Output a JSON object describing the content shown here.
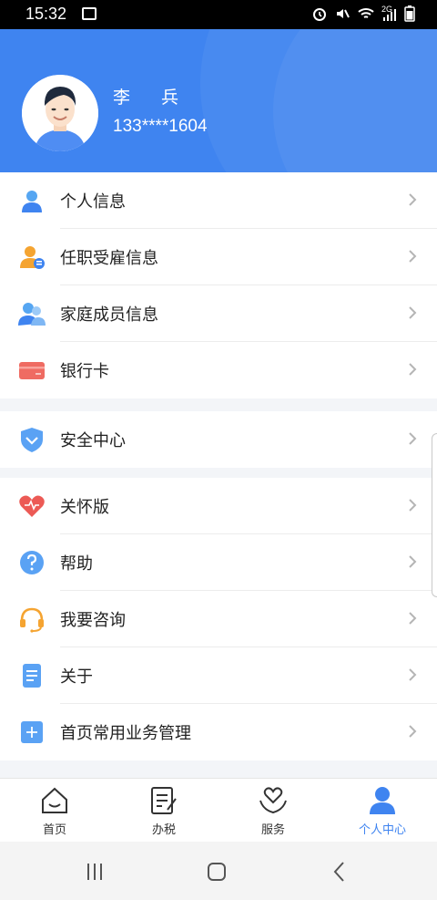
{
  "status_bar": {
    "time": "15:32",
    "icons": [
      "image-icon",
      "alarm-icon",
      "mute-icon",
      "wifi-icon",
      "signal-icon",
      "battery-icon"
    ],
    "network": "2G"
  },
  "profile": {
    "name": "李 兵",
    "phone": "133****1604"
  },
  "menu_groups": [
    [
      {
        "label": "个人信息",
        "icon": "person-icon"
      },
      {
        "label": "任职受雇信息",
        "icon": "employment-icon"
      },
      {
        "label": "家庭成员信息",
        "icon": "family-icon"
      },
      {
        "label": "银行卡",
        "icon": "bank-card-icon"
      }
    ],
    [
      {
        "label": "安全中心",
        "icon": "shield-icon"
      }
    ],
    [
      {
        "label": "关怀版",
        "icon": "heart-icon"
      },
      {
        "label": "帮助",
        "icon": "help-icon"
      },
      {
        "label": "我要咨询",
        "icon": "headset-icon"
      },
      {
        "label": "关于",
        "icon": "document-icon"
      },
      {
        "label": "首页常用业务管理",
        "icon": "plus-square-icon"
      }
    ]
  ],
  "tabs": [
    {
      "label": "首页",
      "icon": "home-icon"
    },
    {
      "label": "办税",
      "icon": "tax-icon"
    },
    {
      "label": "服务",
      "icon": "service-icon"
    },
    {
      "label": "个人中心",
      "icon": "user-center-icon",
      "active": true
    }
  ],
  "colors": {
    "primary": "#3f84f0",
    "active_tab": "#3f84f0"
  }
}
